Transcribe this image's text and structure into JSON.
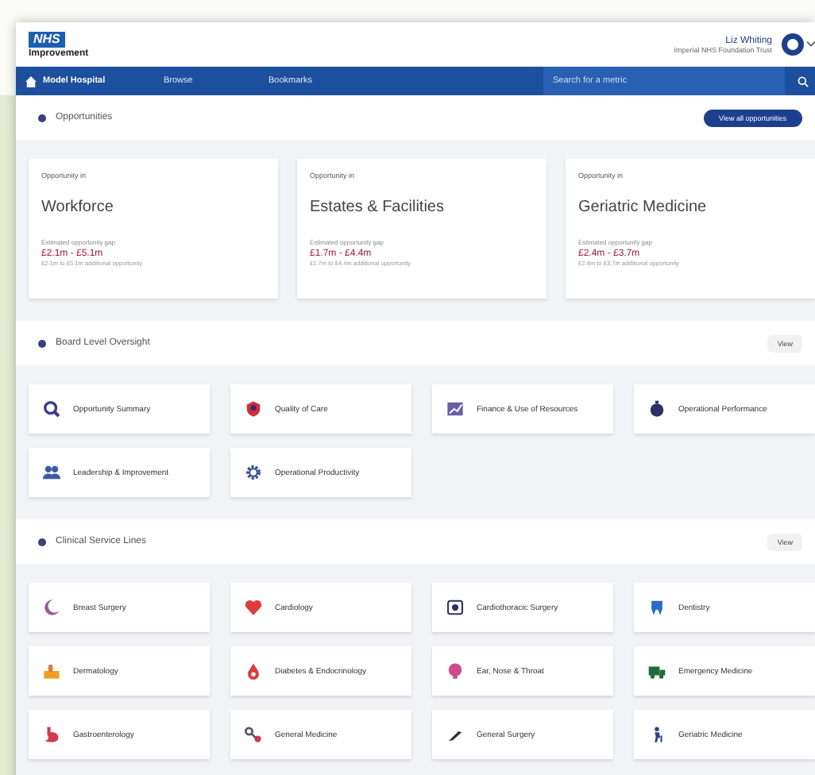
{
  "header": {
    "logo": "NHS",
    "org": "Improvement",
    "user_name": "Liz Whiting",
    "user_org": "Imperial NHS Foundation Trust"
  },
  "nav": {
    "items": [
      {
        "label": "Model Hospital",
        "selected": true
      },
      {
        "label": "Browse",
        "selected": false
      },
      {
        "label": "Bookmarks",
        "selected": false
      }
    ],
    "search": {
      "placeholder": "Search for a metric"
    }
  },
  "opportunities": {
    "title": "Opportunities",
    "button": "View all opportunities",
    "cards": [
      {
        "eyebrow": "Opportunity in",
        "title": "Workforce",
        "caption": "Estimated opportunity gap",
        "value": "£2.1m - £5.1m",
        "note": "£2.1m to £5.1m additional opportunity"
      },
      {
        "eyebrow": "Opportunity in",
        "title": "Estates & Facilities",
        "caption": "Estimated opportunity gap",
        "value": "£1.7m - £4.4m",
        "note": "£1.7m to £4.4m additional opportunity"
      },
      {
        "eyebrow": "Opportunity in",
        "title": "Geriatric Medicine",
        "caption": "Estimated opportunity gap",
        "value": "£2.4m - £3.7m",
        "note": "£2.4m to £3.7m additional opportunity"
      }
    ]
  },
  "board_level_oversight": {
    "title": "Board Level Oversight",
    "button": "View",
    "tiles": [
      "Opportunity Summary",
      "Quality of Care",
      "Finance & Use of Resources",
      "Operational Performance",
      "Leadership & Improvement",
      "Operational Productivity"
    ]
  },
  "clinical_service_lines": {
    "title": "Clinical Service Lines",
    "button": "View",
    "tiles": [
      "Breast Surgery",
      "Cardiology",
      "Cardiothoracic Surgery",
      "Dentistry",
      "Dermatology",
      "Diabetes & Endocrinology",
      "Ear, Nose & Throat",
      "Emergency Medicine",
      "Gastroenterology",
      "General Medicine",
      "General Surgery",
      "Geriatric Medicine"
    ]
  }
}
